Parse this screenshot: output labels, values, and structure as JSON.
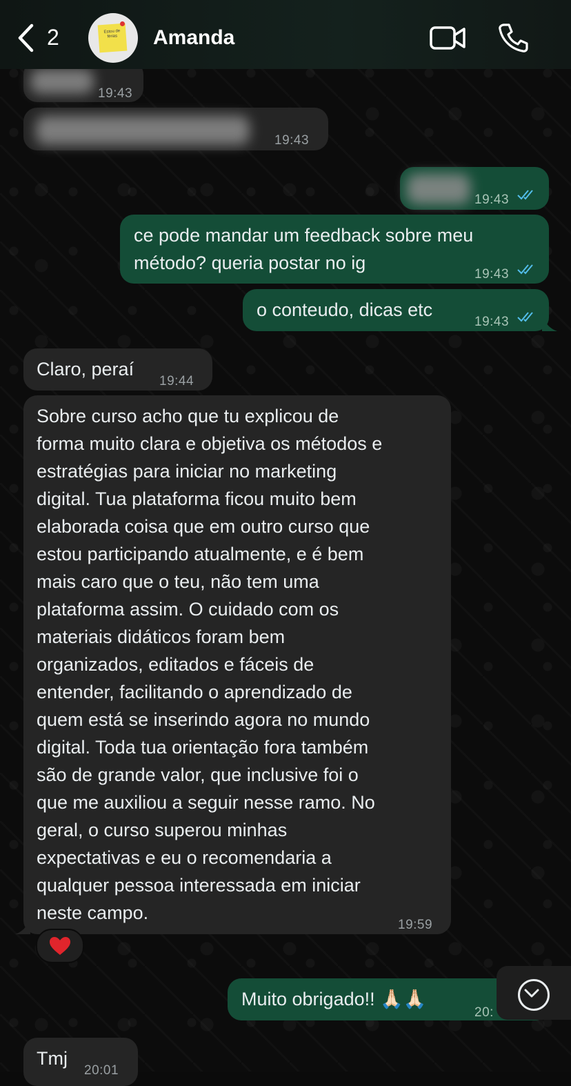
{
  "header": {
    "back_count": "2",
    "contact_name": "Amanda",
    "avatar_note_text": "Estou de férias",
    "icons": [
      "chevron-left-icon",
      "video-call-icon",
      "phone-icon"
    ]
  },
  "messages": [
    {
      "direction": "incoming",
      "text": "",
      "time": "19:43",
      "blurred": true
    },
    {
      "direction": "incoming",
      "text": "",
      "time": "19:43",
      "blurred": true
    },
    {
      "direction": "outgoing",
      "text": "",
      "time": "19:43",
      "blurred": true,
      "status": "read"
    },
    {
      "direction": "outgoing",
      "text": "ce pode mandar um feedback sobre meu\nmétodo? queria postar no ig",
      "time": "19:43",
      "status": "read"
    },
    {
      "direction": "outgoing",
      "text": "o conteudo, dicas etc",
      "time": "19:43",
      "status": "read"
    },
    {
      "direction": "incoming",
      "text": "Claro, peraí",
      "time": "19:44"
    },
    {
      "direction": "incoming",
      "text": "Sobre curso acho que tu explicou de\nforma muito clara e objetiva os métodos e\nestratégias para iniciar no marketing\ndigital. Tua plataforma ficou muito bem\nelaborada coisa que em outro curso que\nestou participando atualmente, e é bem\nmais caro que o teu, não tem uma\nplataforma assim. O cuidado com os\nmateriais didáticos foram bem\norganizados, editados e fáceis de\nentender, facilitando o aprendizado de\nquem está se inserindo agora no mundo\ndigital. Toda tua orientação fora também\nsão de grande valor, que inclusive foi o\nque me auxiliou a seguir nesse ramo. No\ngeral, o curso superou minhas\nexpectativas e eu o recomendaria a\nqualquer pessoa interessada em iniciar\nneste campo.",
      "time": "19:59",
      "reaction": "❤️"
    },
    {
      "direction": "outgoing",
      "text": "Muito obrigado!! 🙏🏻🙏🏻",
      "time": "20:",
      "status": "read"
    },
    {
      "direction": "incoming",
      "text": "Tmj",
      "time": "20:01"
    }
  ],
  "scroll_button": {
    "icon": "chevron-down-circle-icon"
  },
  "colors": {
    "header_bg": "#14211d",
    "incoming_bubble": "#252525",
    "outgoing_bubble": "#144d37",
    "read_ticks": "#53bdeb"
  }
}
